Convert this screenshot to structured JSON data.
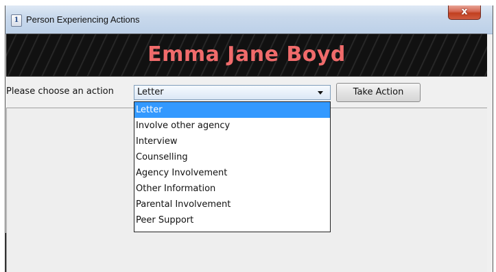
{
  "window": {
    "title": "Person Experiencing Actions",
    "close_label": "x"
  },
  "banner": {
    "person_name": "Emma Jane Boyd"
  },
  "action_bar": {
    "choose_label": "Please choose an action",
    "selected_action": "Letter",
    "take_action_label": "Take Action"
  },
  "dropdown": {
    "options": [
      "Letter",
      "Involve other agency",
      "Interview",
      "Counselling",
      "Agency Involvement",
      "Other Information",
      "Parental Involvement",
      "Peer Support"
    ],
    "highlighted_index": 0
  },
  "colors": {
    "banner_text": "#f06b6b",
    "highlight": "#3399ff",
    "close_button": "#c1401f"
  }
}
